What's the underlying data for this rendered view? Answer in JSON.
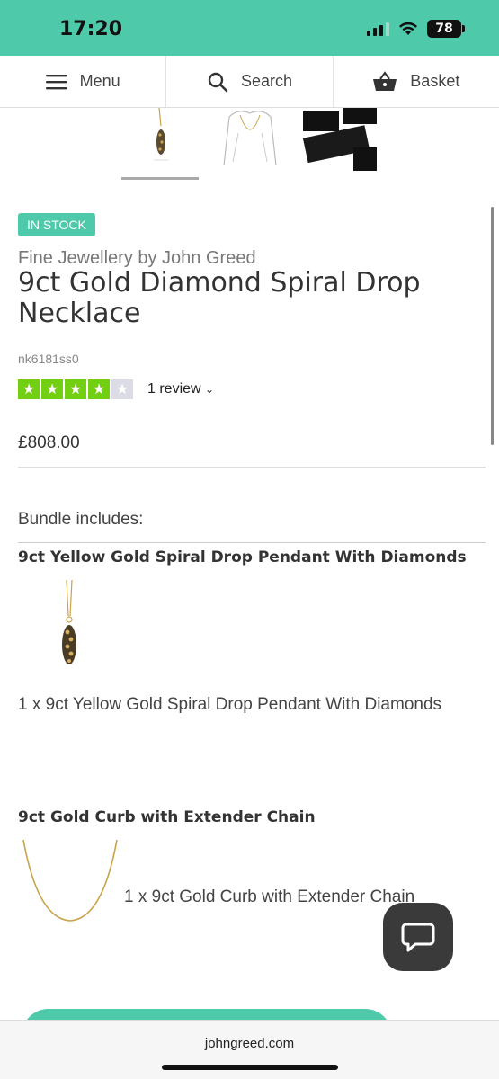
{
  "status": {
    "time": "17:20",
    "battery": "78"
  },
  "nav": {
    "menu": "Menu",
    "search": "Search",
    "basket": "Basket"
  },
  "product": {
    "stock_badge": "IN STOCK",
    "brand": "Fine Jewellery by John Greed",
    "title": "9ct Gold Diamond Spiral Drop Necklace",
    "sku": "nk6181ss0",
    "rating": 4,
    "rating_max": 5,
    "reviews_label": "1 review",
    "price": "£808.00"
  },
  "bundle": {
    "heading": "Bundle includes:",
    "items": [
      {
        "title": "9ct Yellow Gold Spiral Drop Pendant With Diamonds",
        "desc": "1 x 9ct Yellow Gold Spiral Drop Pendant With Diamonds"
      },
      {
        "title": "9ct Gold Curb with Extender Chain",
        "desc": "1 x 9ct Gold Curb with Extender Chain"
      }
    ]
  },
  "browser": {
    "url": "johngreed.com"
  },
  "colors": {
    "accent": "#4ec9a9",
    "star_filled": "#73cf11",
    "star_empty": "#dcdce6",
    "chat": "#3a3a3a"
  }
}
